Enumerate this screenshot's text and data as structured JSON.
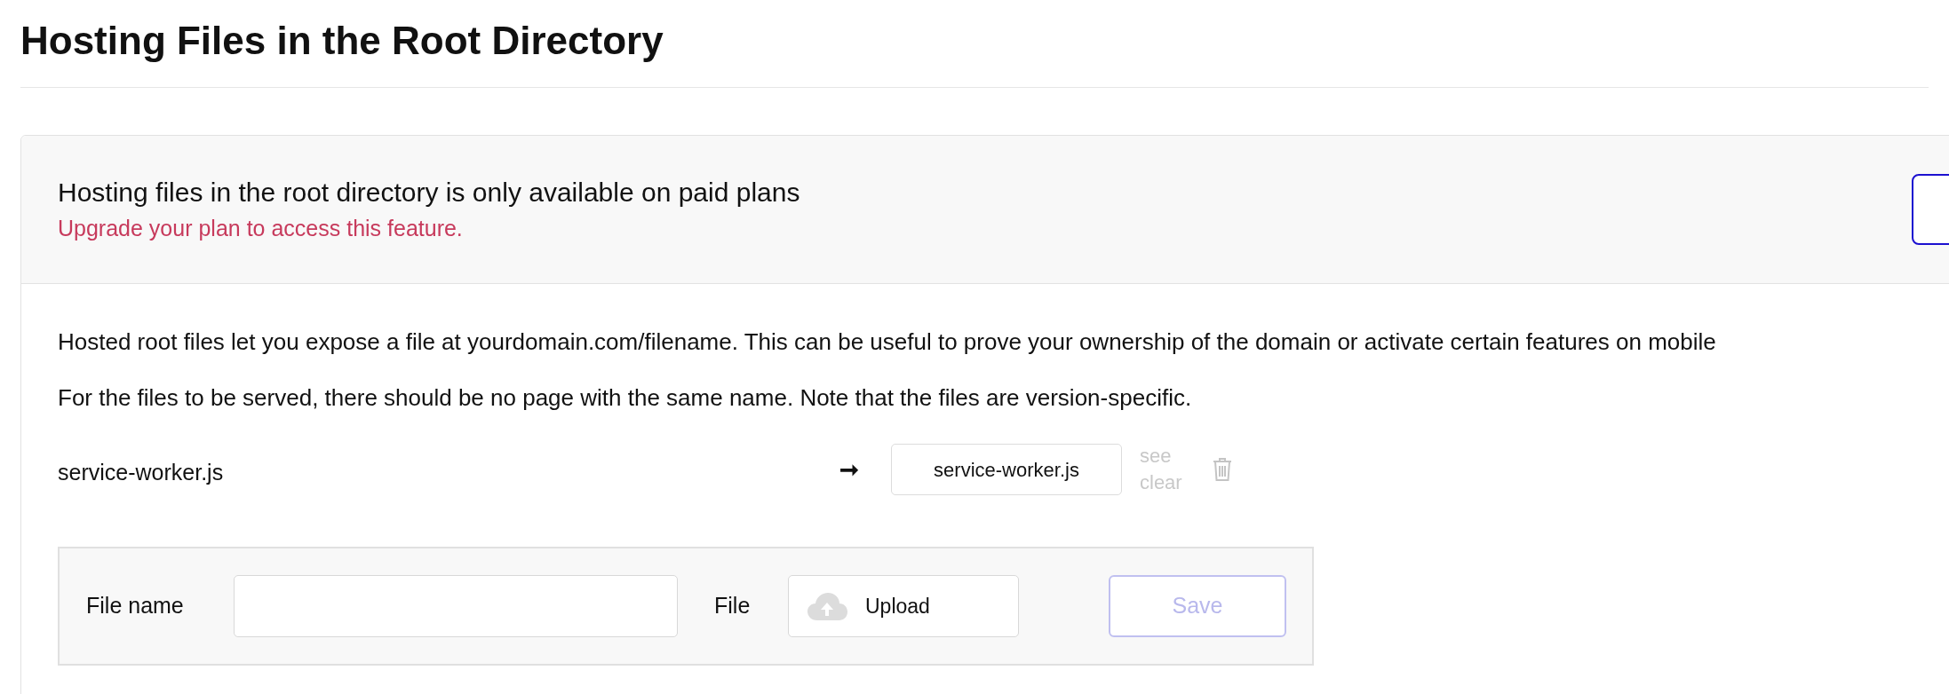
{
  "title": "Hosting Files in the Root Directory",
  "notice": {
    "message": "Hosting files in the root directory is only available on paid plans",
    "action": "Upgrade your plan to access this feature."
  },
  "description": [
    "Hosted root files let you expose a file at yourdomain.com/filename. This can be useful to prove your ownership of the domain or activate certain features on mobile",
    "For the files to be served, there should be no page with the same name. Note that the files are version-specific."
  ],
  "files": [
    {
      "name": "service-worker.js",
      "arrow": "➞",
      "target": "service-worker.js",
      "links": [
        "see",
        "clear"
      ]
    }
  ],
  "form": {
    "file_name_label": "File name",
    "file_label": "File",
    "upload_label": "Upload",
    "save": {
      "label": "Save",
      "disabled": true
    }
  }
}
